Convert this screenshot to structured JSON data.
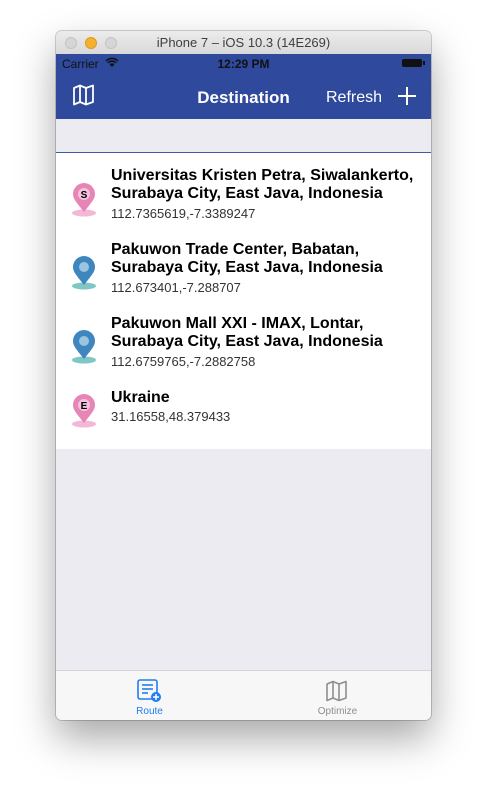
{
  "window": {
    "title": "iPhone 7 – iOS 10.3 (14E269)"
  },
  "status_bar": {
    "carrier": "Carrier",
    "time": "12:29 PM"
  },
  "navbar": {
    "title": "Destination",
    "refresh_label": "Refresh"
  },
  "destinations": [
    {
      "marker": "S",
      "icon": "start-marker",
      "title": "Universitas Kristen Petra, Siwalankerto, Surabaya City, East Java, Indonesia",
      "coords": "112.7365619,-7.3389247"
    },
    {
      "marker": "",
      "icon": "location-pin",
      "title": "Pakuwon Trade Center, Babatan, Surabaya City, East Java, Indonesia",
      "coords": "112.673401,-7.288707"
    },
    {
      "marker": "",
      "icon": "location-pin",
      "title": "Pakuwon Mall XXI - IMAX, Lontar, Surabaya City, East Java, Indonesia",
      "coords": "112.6759765,-7.2882758"
    },
    {
      "marker": "E",
      "icon": "end-marker",
      "title": "Ukraine",
      "coords": "31.16558,48.379433"
    }
  ],
  "tabbar": {
    "tabs": [
      {
        "label": "Route",
        "icon": "route-list-icon",
        "active": true
      },
      {
        "label": "Optimize",
        "icon": "map-icon",
        "active": false
      }
    ]
  },
  "colors": {
    "navbar": "#2f4a9c",
    "active_tab": "#1e7ef2",
    "inactive_tab": "#8e8e93",
    "start_marker": "#e785b6",
    "mid_marker": "#3f86bf"
  }
}
